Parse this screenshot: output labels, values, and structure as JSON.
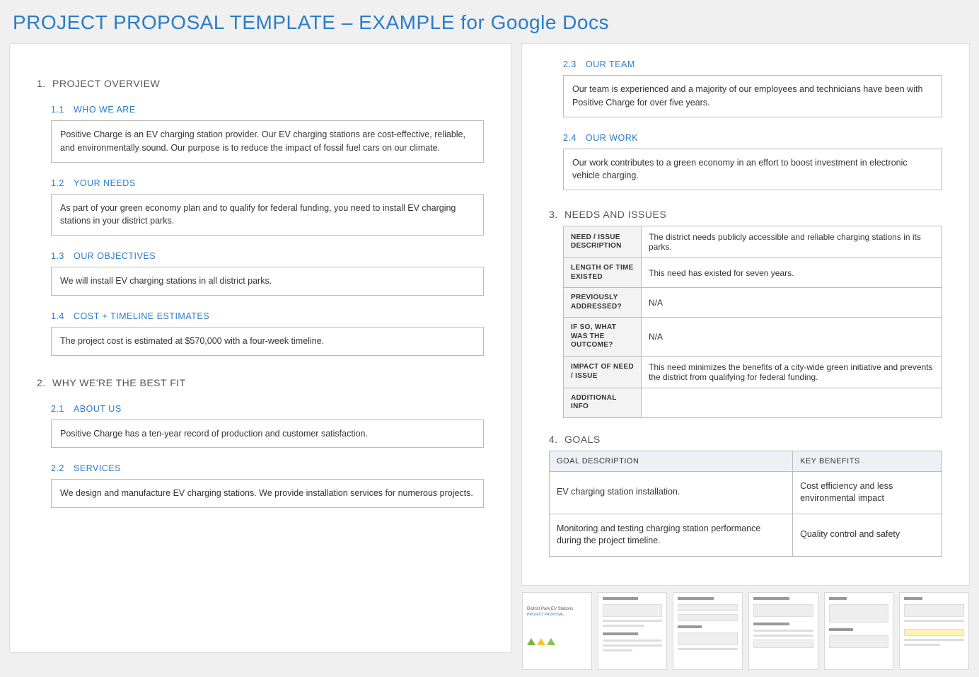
{
  "title": "PROJECT PROPOSAL TEMPLATE – EXAMPLE for Google Docs",
  "s1": {
    "num": "1.",
    "title": "PROJECT OVERVIEW"
  },
  "s1_1": {
    "num": "1.1",
    "title": "WHO WE ARE",
    "body": "Positive Charge is an EV charging station provider. Our EV charging stations are cost-effective, reliable, and environmentally sound. Our purpose is to reduce the impact of fossil fuel cars on our climate."
  },
  "s1_2": {
    "num": "1.2",
    "title": "YOUR NEEDS",
    "body": "As part of your green economy plan and to qualify for federal funding, you need to install EV charging stations in your district parks."
  },
  "s1_3": {
    "num": "1.3",
    "title": "OUR OBJECTIVES",
    "body": "We will install EV charging stations in all district parks."
  },
  "s1_4": {
    "num": "1.4",
    "title": "COST + TIMELINE ESTIMATES",
    "body": "The project cost is estimated at $570,000 with a four-week timeline."
  },
  "s2": {
    "num": "2.",
    "title": "WHY WE'RE THE BEST FIT"
  },
  "s2_1": {
    "num": "2.1",
    "title": "ABOUT US",
    "body": "Positive Charge has a ten-year record of production and customer satisfaction."
  },
  "s2_2": {
    "num": "2.2",
    "title": "SERVICES",
    "body": "We design and manufacture EV charging stations. We provide installation services for numerous projects."
  },
  "s2_3": {
    "num": "2.3",
    "title": "OUR TEAM",
    "body": "Our team is experienced and a majority of our employees and technicians have been with Positive Charge for over five years."
  },
  "s2_4": {
    "num": "2.4",
    "title": "OUR WORK",
    "body": "Our work contributes to a green economy in an effort to boost investment in electronic vehicle charging."
  },
  "s3": {
    "num": "3.",
    "title": "NEEDS AND ISSUES"
  },
  "needs": {
    "r1": {
      "label": "NEED / ISSUE DESCRIPTION",
      "val": "The district needs publicly accessible and reliable charging stations in its parks."
    },
    "r2": {
      "label": "LENGTH OF TIME EXISTED",
      "val": "This need has existed for seven years."
    },
    "r3": {
      "label": "PREVIOUSLY ADDRESSED?",
      "val": "N/A"
    },
    "r4": {
      "label": "IF SO, WHAT WAS THE OUTCOME?",
      "val": "N/A"
    },
    "r5": {
      "label": "IMPACT OF NEED / ISSUE",
      "val": "This need minimizes the benefits of a city-wide green initiative and prevents the district from qualifying for federal funding."
    },
    "r6": {
      "label": "ADDITIONAL INFO",
      "val": ""
    }
  },
  "s4": {
    "num": "4.",
    "title": "GOALS"
  },
  "goals": {
    "h1": "GOAL DESCRIPTION",
    "h2": "KEY BENEFITS",
    "rows": {
      "0": {
        "desc": "EV charging station installation.",
        "ben": "Cost efficiency and less environmental impact"
      },
      "1": {
        "desc": "Monitoring and testing charging station performance during the project timeline.",
        "ben": "Quality control and safety"
      }
    }
  },
  "thumb1_title": "District Park EV Stations",
  "thumb1_sub": "PROJECT PROPOSAL"
}
